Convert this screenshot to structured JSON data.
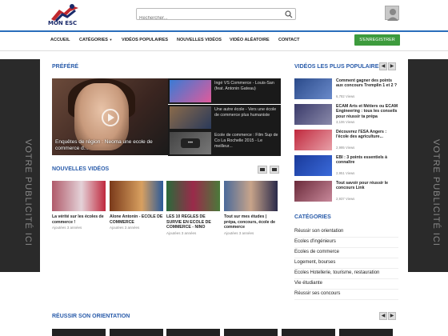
{
  "header": {
    "logo_text": "MON ESC",
    "search_placeholder": "Rechercher..."
  },
  "nav": {
    "items": [
      "ACCUEIL",
      "CATÉGORIES",
      "VIDÉOS POPULAIRES",
      "NOUVELLES VIDÉOS",
      "VIDÉO ALÉATOIRE",
      "CONTACT"
    ],
    "register_label": "S'ENREGISTRER"
  },
  "ads": {
    "left_text": "VOTRE PUBLICITÉ ICI",
    "right_text": "VOTRE PUBLICITÉ ICI"
  },
  "featured": {
    "title": "PRÉFÉRÉ",
    "main_caption": "Enquêtes de région : Neoma une ecole de commerce d...",
    "side_items": [
      "Ingé VS Commerce - Louis-San (feat. Antonin Gateau)",
      "Une autre école - Vers une école de commerce plus humaniste",
      "Ecole de commerce : Film Sup de Co La Rochelle 2015 - Le meilleur..."
    ]
  },
  "new_videos": {
    "title": "NOUVELLES VIDÉOS",
    "items": [
      {
        "title": "La vérité sur les écoles de commerce !",
        "date": "Ajoutées 3 années"
      },
      {
        "title": "Alone Antonin - ECOLE DE COMMERCE",
        "date": "Ajoutées 3 années"
      },
      {
        "title": "LES 10 REGLES DE SURVIE EN ECOLE DE COMMERCE - NINO",
        "date": "Ajoutées 3 années"
      },
      {
        "title": "Tout sur mes études | prépa, concours, école de commerce",
        "date": "Ajoutées 3 années"
      }
    ]
  },
  "popular": {
    "title": "VIDÉOS LES PLUS POPULAIRES",
    "items": [
      {
        "title": "Comment gagner des points aux concours Tremplin 1 et 2 ?",
        "views": "6,782 Views"
      },
      {
        "title": "ECAM Arts et Métiers ou ECAM Engineering : tous les conseils pour réussir ta prépa",
        "views": "3,106 Views"
      },
      {
        "title": "Découvrez l'ESA Angers : l'école des agriculture...",
        "views": "2,995 Views"
      },
      {
        "title": "EBI : 3 points essentiels à connaître",
        "views": "2,951 Views"
      },
      {
        "title": "Tout savoir pour réussir le concours Link",
        "views": "2,937 Views"
      }
    ]
  },
  "categories": {
    "title": "CATÉGORIES",
    "items": [
      "Réussir son orientation",
      "Ecoles d'ingénieurs",
      "Ecoles de commerce",
      "Logement, bourses",
      "Ecoles Hotellerie, tourisme, restauration",
      "Vie étudiante",
      "Réussir ses concours"
    ]
  },
  "bottom_section": {
    "title": "RÉUSSIR SON ORIENTATION"
  },
  "colors": {
    "accent_blue": "#2a5caa",
    "register_green": "#3d9b3d",
    "nav_border": "#2a6ebb"
  }
}
